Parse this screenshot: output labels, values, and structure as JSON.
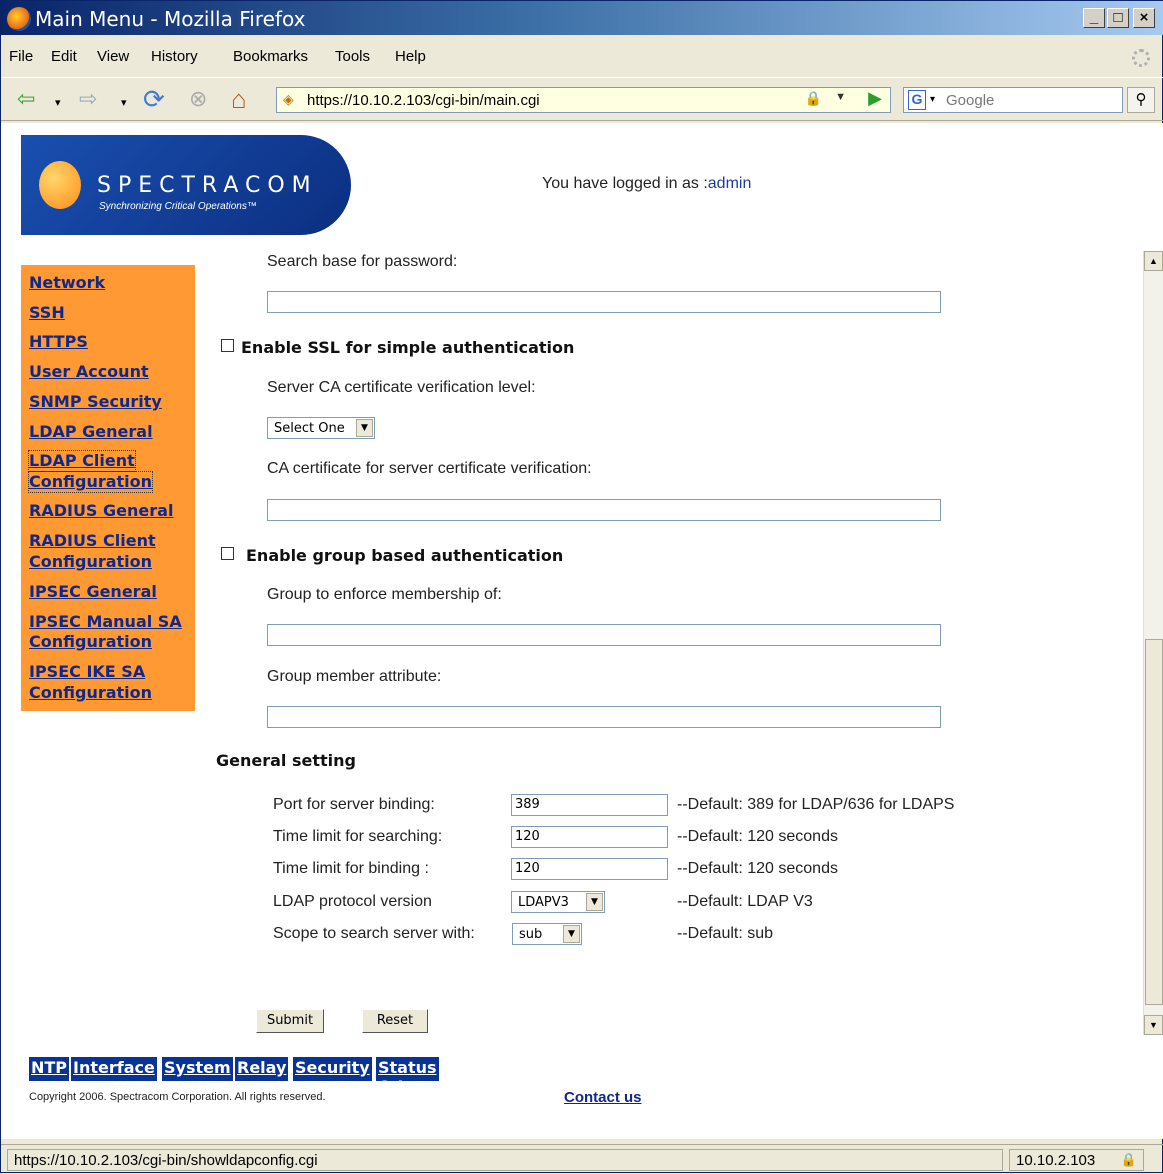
{
  "window": {
    "title": "Main Menu - Mozilla Firefox",
    "min": "_",
    "max": "□",
    "close": "×"
  },
  "menu": [
    "File",
    "Edit",
    "View",
    "History",
    "Bookmarks",
    "Tools",
    "Help"
  ],
  "toolbar": {
    "back": "⇦",
    "forward": "⇨",
    "reload": "⟳",
    "stop": "⊗",
    "home": "⌂",
    "url": "https://10.10.2.103/cgi-bin/main.cgi",
    "search_placeholder": "Google",
    "search_engine": "G"
  },
  "header": {
    "brand": "SPECTRACOM",
    "tagline": "Synchronizing Critical Operations™",
    "logged_in_label": "You have logged in as :",
    "user": "admin"
  },
  "sidebar": [
    "Network",
    "SSH",
    "HTTPS",
    "User Account",
    "SNMP Security",
    "LDAP General",
    "LDAP Client",
    "Configuration",
    "RADIUS General",
    "RADIUS Client",
    "Configuration",
    "IPSEC General",
    "IPSEC Manual SA",
    "Configuration",
    "IPSEC IKE SA",
    "Configuration"
  ],
  "form": {
    "search_base_password": "Search base for password:",
    "enable_ssl": "Enable SSL for simple authentication",
    "ca_level_label": "Server CA certificate verification level:",
    "ca_level_value": "Select One",
    "ca_cert_label": "CA certificate for server certificate verification:",
    "enable_group": "Enable group based authentication",
    "group_label": "Group to enforce membership of:",
    "member_attr_label": "Group member attribute:",
    "general_heading": "General setting",
    "settings": [
      {
        "label": "Port for server binding:",
        "value": "389",
        "hint": "--Default: 389 for LDAP/636 for LDAPS"
      },
      {
        "label": "Time limit for searching:",
        "value": "120",
        "hint": "--Default: 120 seconds"
      },
      {
        "label": "Time limit for binding :",
        "value": "120",
        "hint": "--Default: 120 seconds"
      },
      {
        "label": "LDAP protocol version",
        "value": "LDAPV3",
        "hint": "--Default: LDAP V3"
      },
      {
        "label": "Scope to search server with:",
        "value": "sub",
        "hint": "--Default: sub"
      }
    ],
    "submit": "Submit",
    "reset": "Reset"
  },
  "bottom_nav": [
    "NTP",
    "Interface",
    "System",
    "Relay",
    "Security",
    "Status & Log"
  ],
  "footer": {
    "copyright": "Copyright 2006. Spectracom Corporation. All rights reserved.",
    "contact": "Contact us"
  },
  "status": {
    "url": "https://10.10.2.103/cgi-bin/showldapconfig.cgi",
    "host": "10.10.2.103"
  }
}
